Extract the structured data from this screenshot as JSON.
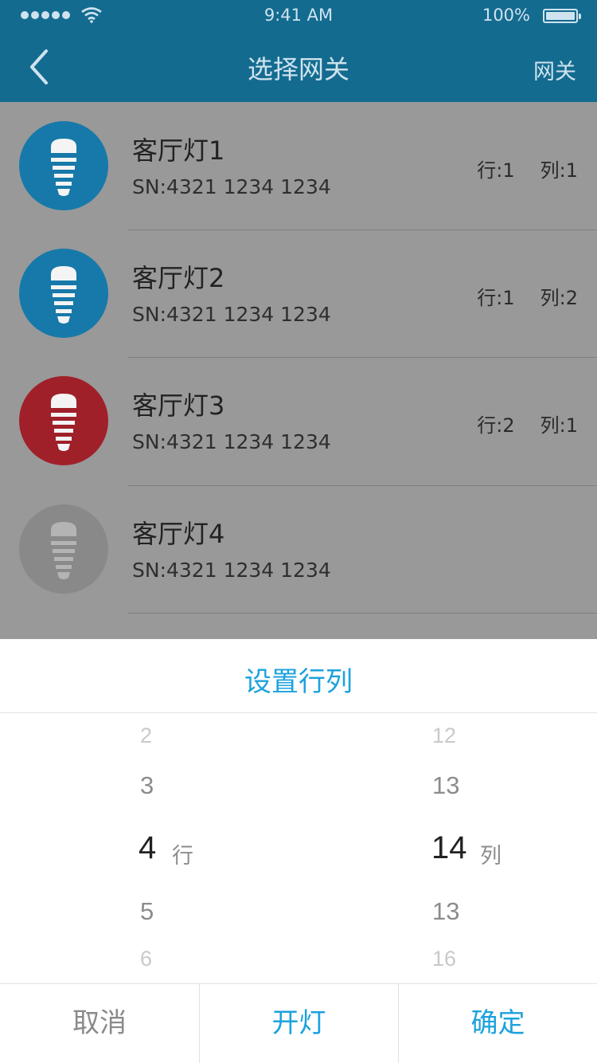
{
  "status_bar": {
    "time": "9:41 AM",
    "battery": "100%"
  },
  "nav": {
    "back_icon": "chevron-left-icon",
    "title": "选择网关",
    "right_label": "网关"
  },
  "lights": [
    {
      "name": "客厅灯1",
      "sn": "SN:4321 1234 1234",
      "row": "行:1",
      "col": "列:1",
      "color": "#1779a9"
    },
    {
      "name": "客厅灯2",
      "sn": "SN:4321 1234 1234",
      "row": "行:1",
      "col": "列:2",
      "color": "#1779a9"
    },
    {
      "name": "客厅灯3",
      "sn": "SN:4321 1234 1234",
      "row": "行:2",
      "col": "列:1",
      "color": "#a0202a"
    },
    {
      "name": "客厅灯4",
      "sn": "SN:4321 1234 1234",
      "row": "",
      "col": "",
      "color": "#898989"
    }
  ],
  "sheet": {
    "title": "设置行列",
    "row_picker": {
      "items": [
        "2",
        "3",
        "4",
        "5",
        "6"
      ],
      "selected": "4",
      "unit": "行"
    },
    "col_picker": {
      "items": [
        "12",
        "13",
        "14",
        "13",
        "16"
      ],
      "selected": "14",
      "unit": "列"
    },
    "buttons": {
      "cancel": "取消",
      "light_on": "开灯",
      "confirm": "确定"
    }
  },
  "colors": {
    "nav_bg": "#146b90",
    "accent": "#1ca2dd",
    "overlay": "#999999"
  }
}
